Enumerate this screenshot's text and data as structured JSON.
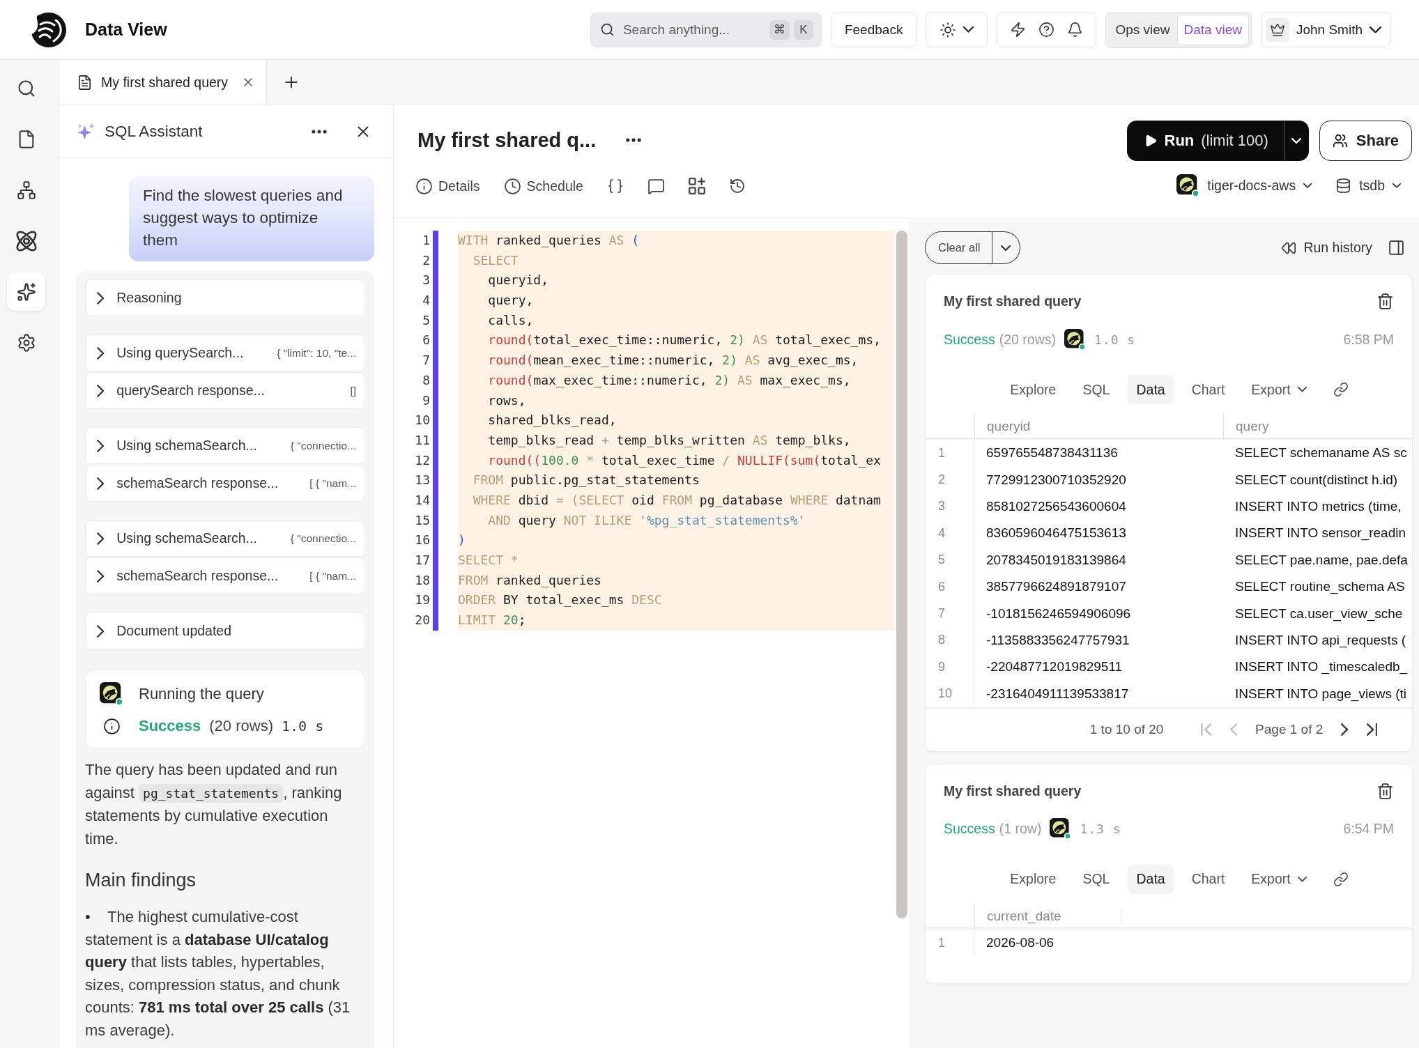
{
  "header": {
    "title": "Data View",
    "search": {
      "placeholder": "Search anything...",
      "keys": [
        "⌘",
        "K"
      ]
    },
    "feedback": "Feedback",
    "views": [
      {
        "label": "Ops view",
        "selected": false
      },
      {
        "label": "Data view",
        "selected": true
      }
    ],
    "user": "John Smith"
  },
  "nav": [
    {
      "selected": false
    },
    {
      "selected": false
    },
    {
      "selected": false
    },
    {
      "selected": false
    },
    {
      "selected": true
    },
    {
      "selected": false
    }
  ],
  "tabs": [
    {
      "label": "My first shared query",
      "selected": true
    }
  ],
  "assistant": {
    "title": "SQL Assistant",
    "prompt": "Find the slowest queries and suggest ways to optimize them",
    "step_groups": [
      {
        "steps": [
          {
            "label": "Reasoning",
            "expanded": false
          }
        ]
      },
      {
        "steps": [
          {
            "label": "Using querySearch...",
            "detail": "{ \"limit\": 10, \"te...",
            "expanded": false
          },
          {
            "label": "querySearch response...",
            "detail": "[]",
            "expanded": false
          }
        ]
      },
      {
        "steps": [
          {
            "label": "Using schemaSearch...",
            "detail": "{ \"connectio...",
            "expanded": false
          },
          {
            "label": "schemaSearch response...",
            "detail": "[ { \"nam...",
            "expanded": false
          }
        ]
      },
      {
        "steps": [
          {
            "label": "Using schemaSearch...",
            "detail": "{ \"connectio...",
            "expanded": false
          },
          {
            "label": "schemaSearch response...",
            "detail": "[ { \"nam...",
            "expanded": false
          }
        ]
      },
      {
        "steps": [
          {
            "label": "Document updated",
            "expanded": false
          }
        ]
      }
    ],
    "run": {
      "title": "Running the query",
      "status": {
        "kind": "success",
        "label": "Success"
      },
      "row_count": "(20 rows)",
      "duration": "1.0 s"
    },
    "summary": {
      "before": "The query has been updated and run against",
      "code": "pg_stat_statements",
      "after": ", ranking statements by cumulative execution time."
    },
    "findings_title": "Main findings",
    "findings": [
      {
        "marker": "•",
        "text": "The highest cumulative-cost statement is a **database UI/catalog query** that lists tables, hypertables, sizes, compression status, and chunk counts: **781 ms total over 25 calls** (31 ms average)."
      }
    ]
  },
  "query": {
    "title": "My first shared q...",
    "actions": [
      "Details",
      "Schedule"
    ],
    "run": {
      "label": "Run",
      "limit": "(limit 100)"
    },
    "share": "Share",
    "service": "tiger-docs-aws",
    "database": "tsdb"
  },
  "editor": {
    "lines": [
      {
        "number": "1",
        "tokens": [
          {
            "kind": "keyword",
            "text": "WITH"
          },
          {
            "kind": "name",
            "text": " ranked_queries "
          },
          {
            "kind": "keyword",
            "text": "AS "
          },
          {
            "kind": "bracket",
            "text": "("
          }
        ]
      },
      {
        "number": "2",
        "tokens": [
          {
            "kind": "keyword",
            "text": "  SELECT"
          }
        ]
      },
      {
        "number": "3",
        "tokens": [
          {
            "kind": "name",
            "text": "    queryid,"
          }
        ]
      },
      {
        "number": "4",
        "tokens": [
          {
            "kind": "name",
            "text": "    query,"
          }
        ]
      },
      {
        "number": "5",
        "tokens": [
          {
            "kind": "name",
            "text": "    calls,"
          }
        ]
      },
      {
        "number": "6",
        "tokens": [
          {
            "kind": "function",
            "text": "    round("
          },
          {
            "kind": "name",
            "text": "total_exec_time::numeric, "
          },
          {
            "kind": "number",
            "text": "2) "
          },
          {
            "kind": "keyword",
            "text": "AS"
          },
          {
            "kind": "name",
            "text": " total_exec_ms,"
          }
        ]
      },
      {
        "number": "7",
        "tokens": [
          {
            "kind": "function",
            "text": "    round("
          },
          {
            "kind": "name",
            "text": "mean_exec_time::numeric, "
          },
          {
            "kind": "number",
            "text": "2) "
          },
          {
            "kind": "keyword",
            "text": "AS"
          },
          {
            "kind": "name",
            "text": " avg_exec_ms,"
          }
        ]
      },
      {
        "number": "8",
        "tokens": [
          {
            "kind": "function",
            "text": "    round("
          },
          {
            "kind": "name",
            "text": "max_exec_time::numeric, "
          },
          {
            "kind": "number",
            "text": "2) "
          },
          {
            "kind": "keyword",
            "text": "AS"
          },
          {
            "kind": "name",
            "text": " max_exec_ms,"
          }
        ]
      },
      {
        "number": "9",
        "tokens": [
          {
            "kind": "name",
            "text": "    rows,"
          }
        ]
      },
      {
        "number": "10",
        "tokens": [
          {
            "kind": "name",
            "text": "    shared_blks_read,"
          }
        ]
      },
      {
        "number": "11",
        "tokens": [
          {
            "kind": "name",
            "text": "    temp_blks_read "
          },
          {
            "kind": "operator",
            "text": "+ "
          },
          {
            "kind": "name",
            "text": "temp_blks_written "
          },
          {
            "kind": "keyword",
            "text": "AS"
          },
          {
            "kind": "name",
            "text": " temp_blks,"
          }
        ]
      },
      {
        "number": "12",
        "tokens": [
          {
            "kind": "function",
            "text": "    round(("
          },
          {
            "kind": "number",
            "text": "100.0 "
          },
          {
            "kind": "operator",
            "text": "* "
          },
          {
            "kind": "name",
            "text": "total_exec_time "
          },
          {
            "kind": "operator",
            "text": "/ "
          },
          {
            "kind": "function",
            "text": "NULLIF(sum("
          },
          {
            "kind": "name",
            "text": "total_ex"
          }
        ]
      },
      {
        "number": "13",
        "tokens": [
          {
            "kind": "keyword",
            "text": "  FROM"
          },
          {
            "kind": "name",
            "text": " public.pg_stat_statements"
          }
        ]
      },
      {
        "number": "14",
        "tokens": [
          {
            "kind": "keyword",
            "text": "  WHERE"
          },
          {
            "kind": "name",
            "text": " dbid "
          },
          {
            "kind": "operator",
            "text": "= "
          },
          {
            "kind": "keyword",
            "text": "(SELECT"
          },
          {
            "kind": "name",
            "text": " oid "
          },
          {
            "kind": "keyword",
            "text": "FROM"
          },
          {
            "kind": "name",
            "text": " pg_database "
          },
          {
            "kind": "keyword",
            "text": "WHERE"
          },
          {
            "kind": "name",
            "text": " datnam"
          }
        ]
      },
      {
        "number": "15",
        "tokens": [
          {
            "kind": "keyword",
            "text": "    AND"
          },
          {
            "kind": "name",
            "text": " query "
          },
          {
            "kind": "keyword",
            "text": "NOT ILIKE "
          },
          {
            "kind": "string",
            "text": "'%pg_stat_statements%'"
          }
        ]
      },
      {
        "number": "16",
        "tokens": [
          {
            "kind": "bracket",
            "text": ")"
          }
        ]
      },
      {
        "number": "17",
        "tokens": [
          {
            "kind": "keyword",
            "text": "SELECT "
          },
          {
            "kind": "operator",
            "text": "*"
          }
        ]
      },
      {
        "number": "18",
        "tokens": [
          {
            "kind": "keyword",
            "text": "FROM"
          },
          {
            "kind": "name",
            "text": " ranked_queries"
          }
        ]
      },
      {
        "number": "19",
        "tokens": [
          {
            "kind": "keyword",
            "text": "ORDER"
          },
          {
            "kind": "name",
            "text": " BY total_exec_ms "
          },
          {
            "kind": "keyword",
            "text": "DESC"
          }
        ]
      },
      {
        "number": "20",
        "tokens": [
          {
            "kind": "keyword",
            "text": "LIMIT "
          },
          {
            "kind": "number",
            "text": "20"
          },
          {
            "kind": "name",
            "text": ";"
          }
        ]
      }
    ]
  },
  "results": {
    "clear": "Clear all",
    "history": "Run history",
    "runs": [
      {
        "title": "My first shared query",
        "status": {
          "kind": "success",
          "label": "Success"
        },
        "row_count": "(20 rows)",
        "duration": "1.0 s",
        "time": "6:58 PM",
        "tabs": [
          {
            "label": "Explore",
            "selected": false,
            "kind": "tab"
          },
          {
            "label": "SQL",
            "selected": false,
            "kind": "tab"
          },
          {
            "label": "Data",
            "selected": true,
            "kind": "tab"
          },
          {
            "label": "Chart",
            "selected": false,
            "kind": "tab"
          },
          {
            "label": "Export",
            "selected": false,
            "kind": "menu"
          }
        ],
        "columns": [
          "queryid",
          "query"
        ],
        "rows": [
          {
            "number": "1",
            "cells": [
              "659765548738431136",
              "SELECT schemaname AS sc"
            ]
          },
          {
            "number": "2",
            "cells": [
              "7729912300710352920",
              "SELECT count(distinct h.id)"
            ]
          },
          {
            "number": "3",
            "cells": [
              "8581027256543600604",
              "INSERT INTO metrics (time,"
            ]
          },
          {
            "number": "4",
            "cells": [
              "8360596046475153613",
              "INSERT INTO sensor_readin"
            ]
          },
          {
            "number": "5",
            "cells": [
              "2078345019183139864",
              "SELECT pae.name, pae.defa"
            ]
          },
          {
            "number": "6",
            "cells": [
              "3857796624891879107",
              "SELECT routine_schema AS"
            ]
          },
          {
            "number": "7",
            "cells": [
              "-1018156246594906096",
              "SELECT ca.user_view_sche"
            ]
          },
          {
            "number": "8",
            "cells": [
              "-1135883356247757931",
              "INSERT INTO api_requests ("
            ]
          },
          {
            "number": "9",
            "cells": [
              "-220487712019829511",
              "INSERT INTO _timescaledb_"
            ]
          },
          {
            "number": "10",
            "cells": [
              "-2316404911139533817",
              "INSERT INTO page_views (ti"
            ]
          }
        ],
        "pager": {
          "range": "1 to 10 of 20",
          "page": "Page 1 of 2",
          "back": [
            {
              "disabled": true
            },
            {
              "disabled": true
            }
          ],
          "forward": [
            {
              "disabled": false
            },
            {
              "disabled": false
            }
          ]
        }
      },
      {
        "title": "My first shared query",
        "status": {
          "kind": "success",
          "label": "Success"
        },
        "row_count": "(1 row)",
        "duration": "1.3 s",
        "time": "6:54 PM",
        "tabs": [
          {
            "label": "Explore",
            "selected": false,
            "kind": "tab"
          },
          {
            "label": "SQL",
            "selected": false,
            "kind": "tab"
          },
          {
            "label": "Data",
            "selected": true,
            "kind": "tab"
          },
          {
            "label": "Chart",
            "selected": false,
            "kind": "tab"
          },
          {
            "label": "Export",
            "selected": false,
            "kind": "menu"
          }
        ],
        "columns": [
          "current_date"
        ],
        "rows": [
          {
            "number": "1",
            "cells": [
              "2026-08-06"
            ]
          }
        ]
      }
    ]
  }
}
